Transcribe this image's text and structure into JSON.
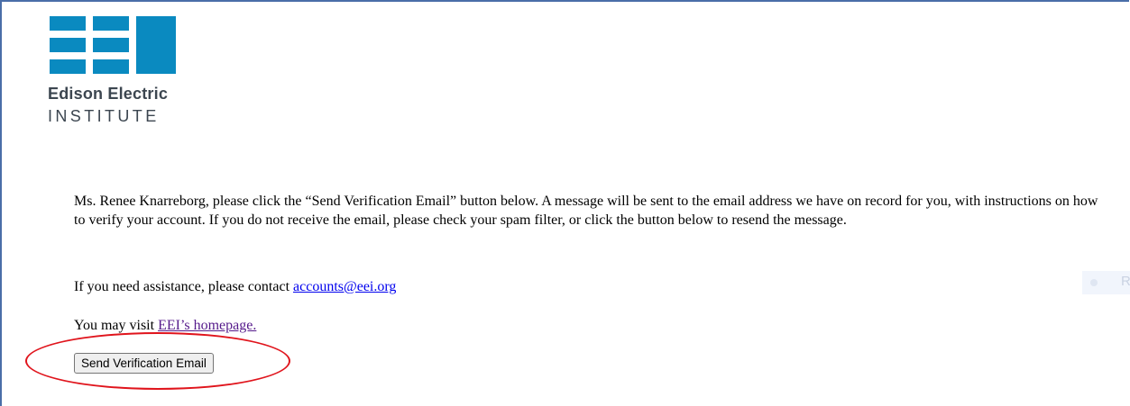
{
  "logo": {
    "letters": "EEI",
    "name": "Edison Electric",
    "subtitle": "INSTITUTE",
    "color": "#0a8ac0"
  },
  "message": {
    "paragraph": "Ms. Renee Knarreborg, please click the “Send Verification Email” button below. A message will be sent to the email address we have on record for you, with instructions on how to verify your account. If you do not receive the email, please check your spam filter, or click the button below to resend the message."
  },
  "assistance": {
    "prefix": "If you need assistance, please contact ",
    "email": "accounts@eei.org"
  },
  "visit": {
    "prefix": "You may visit ",
    "link": "EEI’s homepage."
  },
  "button": {
    "label": "Send Verification Email"
  },
  "faint_control": {
    "letter": "R"
  },
  "annotation_color": "#e0141c"
}
